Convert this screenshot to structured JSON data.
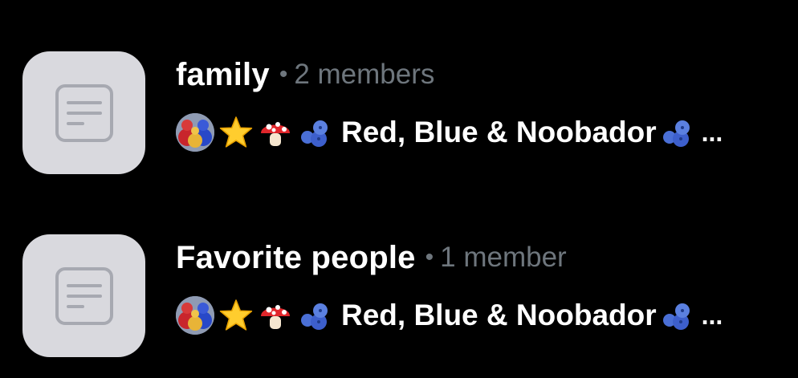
{
  "lists": [
    {
      "name": "family",
      "separator": "•",
      "member_count": "2 members",
      "owner": {
        "avatar_icon": "avatar-icon",
        "emoji_icons": [
          "star-icon",
          "mushroom-icon",
          "blueberries-icon"
        ],
        "name": "Red, Blue & Noobador",
        "trailing_icon": "blueberries-icon",
        "ellipsis": "..."
      }
    },
    {
      "name": "Favorite people",
      "separator": "•",
      "member_count": "1 member",
      "owner": {
        "avatar_icon": "avatar-icon",
        "emoji_icons": [
          "star-icon",
          "mushroom-icon",
          "blueberries-icon"
        ],
        "name": "Red, Blue & Noobador",
        "trailing_icon": "blueberries-icon",
        "ellipsis": "..."
      }
    }
  ],
  "colors": {
    "background": "#000000",
    "thumb": "#d9d9de",
    "thumb_icon": "#a7a9b1",
    "meta_text": "#6e767d",
    "text": "#ffffff"
  }
}
